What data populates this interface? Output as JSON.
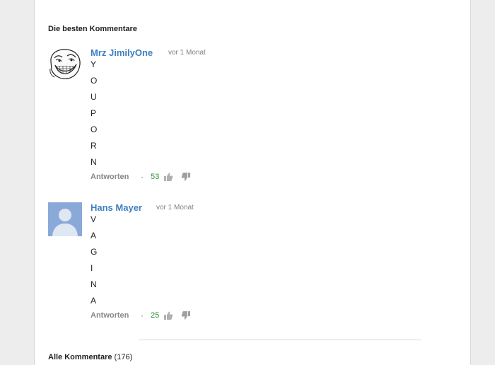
{
  "section_title": "Die besten Kommentare",
  "comments": [
    {
      "author": "Mrz JimilyOne",
      "time": "vor 1 Monat",
      "letters": [
        "Y",
        "O",
        "U",
        "P",
        "O",
        "R",
        "N"
      ],
      "reply_label": "Antworten",
      "votes": "53",
      "avatar_icon": "trollface-avatar"
    },
    {
      "author": "Hans Mayer",
      "time": "vor 1 Monat",
      "letters": [
        "V",
        "A",
        "G",
        "I",
        "N",
        "A"
      ],
      "reply_label": "Antworten",
      "votes": "25",
      "avatar_icon": "default-user-avatar"
    }
  ],
  "all_comments": {
    "label": "Alle Kommentare",
    "count": "(176)"
  },
  "colors": {
    "author": "#3c7fbf",
    "votes": "#2e8b2e",
    "avatar_bg": "#8aa9d9"
  }
}
